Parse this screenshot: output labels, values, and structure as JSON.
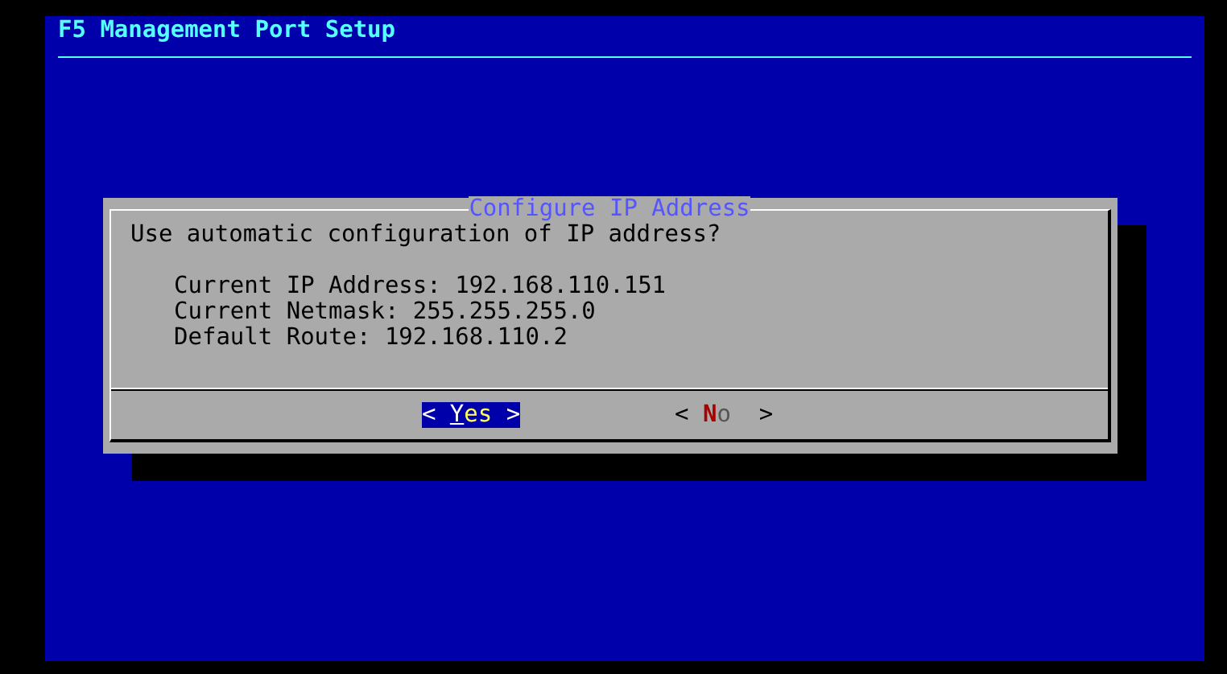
{
  "screen": {
    "title": "F5 Management Port Setup"
  },
  "dialog": {
    "title": "Configure IP Address",
    "question": "Use automatic configuration of IP address?",
    "details": [
      "Current IP Address: 192.168.110.151",
      "Current Netmask: 255.255.255.0",
      "Default Route: 192.168.110.2"
    ],
    "buttons": [
      {
        "open": "<",
        "label": "Yes",
        "close": ">",
        "selected": true
      },
      {
        "open": "<",
        "label": "No",
        "close": ">",
        "selected": false
      }
    ]
  }
}
